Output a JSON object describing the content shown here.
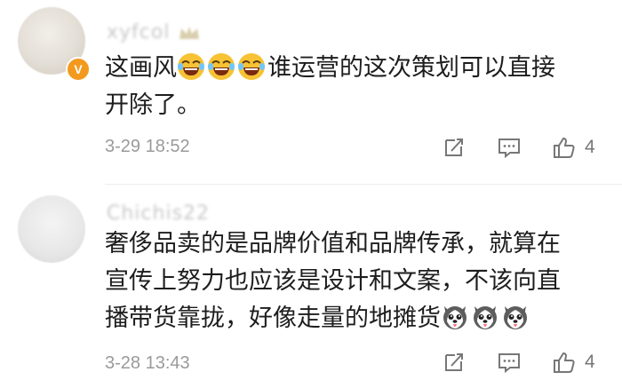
{
  "comments": [
    {
      "username": "xyfcol",
      "text_line1_a": "这画风",
      "text_line1_b": "谁运营的这次策划可以直接",
      "text_line2": "开除了。",
      "emoji_tail": "laughing-crying-emoji",
      "timestamp": "3-29 18:52",
      "likes": "4",
      "badge": "V"
    },
    {
      "username": "Chichis22",
      "text_line1": "奢侈品卖的是品牌价值和品牌传承，就算在",
      "text_line2": "宣传上努力也应该是设计和文案，不该向直",
      "text_line3": "播带货靠拢，好像走量的地摊货",
      "emoji_tail": "husky-dog-emoji",
      "timestamp": "3-28 13:43",
      "likes": "4"
    }
  ],
  "colors": {
    "badge": "#f39a1e",
    "emoji_face": "#f7c234",
    "meta_text": "#9a9a9a"
  }
}
